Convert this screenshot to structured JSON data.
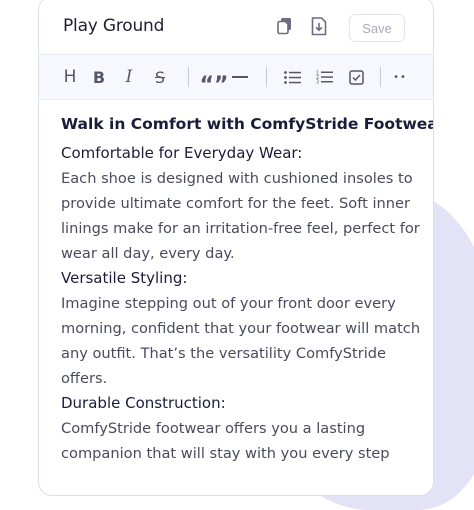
{
  "header": {
    "title": "Play Ground",
    "save_label": "Save"
  },
  "icons": {
    "copy": "copy-icon",
    "download": "download-icon"
  },
  "toolbar": {
    "items": [
      "heading-icon",
      "bold-icon",
      "italic-icon",
      "strikethrough-icon",
      "blockquote-icon",
      "horizontal-rule-icon",
      "bullet-list-icon",
      "ordered-list-icon",
      "task-list-icon",
      "more-icon"
    ],
    "heading": "H",
    "bold": "B",
    "italic": "I",
    "strike": "S",
    "quote": "“”",
    "more": "••"
  },
  "document": {
    "title": "Walk in Comfort with ComfyStride Footwear",
    "sections": [
      {
        "heading": "Comfortable for Everyday Wear:",
        "lines": [
          "Each shoe is designed with cushioned insoles to",
          "provide ultimate comfort for the feet. Soft inner",
          "linings make for an irritation-free feel, perfect for",
          "wear all day, every day."
        ]
      },
      {
        "heading": "Versatile Styling:",
        "lines": [
          "Imagine stepping out of your front door every",
          "morning, confident that your footwear will match",
          "any outfit. That’s the versatility ComfyStride",
          "offers."
        ]
      },
      {
        "heading": "Durable Construction:",
        "lines": [
          "ComfyStride footwear offers you a lasting",
          "companion that will stay with you every step"
        ]
      }
    ]
  },
  "colors": {
    "accent_bg": "#e3e2f6",
    "toolbar_bg": "#f7f8fd",
    "heading_text": "#1b1c3a",
    "body_text": "#4a4b5c"
  }
}
